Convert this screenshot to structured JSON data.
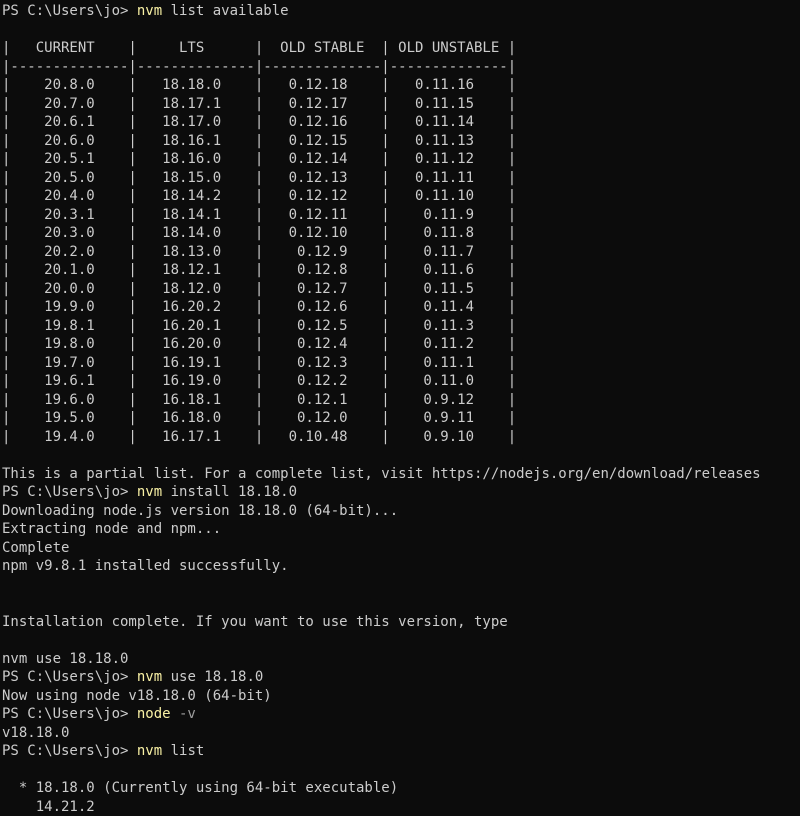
{
  "terminal": {
    "background": "#0c0c0c",
    "foreground": "#cccccc",
    "command_color": "#f9f1a5",
    "flag_color": "#9e9e9e",
    "lines": [
      {
        "type": "prompt",
        "prompt": "PS C:\\Users\\jo> ",
        "cmd": "nvm",
        "args": " list available"
      },
      {
        "type": "text",
        "text": ""
      },
      {
        "type": "text",
        "text": "|   CURRENT    |     LTS      |  OLD STABLE  | OLD UNSTABLE |"
      },
      {
        "type": "text",
        "text": "|--------------|--------------|--------------|--------------|"
      },
      {
        "type": "text",
        "text": "|    20.8.0    |   18.18.0    |   0.12.18    |   0.11.16    |"
      },
      {
        "type": "text",
        "text": "|    20.7.0    |   18.17.1    |   0.12.17    |   0.11.15    |"
      },
      {
        "type": "text",
        "text": "|    20.6.1    |   18.17.0    |   0.12.16    |   0.11.14    |"
      },
      {
        "type": "text",
        "text": "|    20.6.0    |   18.16.1    |   0.12.15    |   0.11.13    |"
      },
      {
        "type": "text",
        "text": "|    20.5.1    |   18.16.0    |   0.12.14    |   0.11.12    |"
      },
      {
        "type": "text",
        "text": "|    20.5.0    |   18.15.0    |   0.12.13    |   0.11.11    |"
      },
      {
        "type": "text",
        "text": "|    20.4.0    |   18.14.2    |   0.12.12    |   0.11.10    |"
      },
      {
        "type": "text",
        "text": "|    20.3.1    |   18.14.1    |   0.12.11    |    0.11.9    |"
      },
      {
        "type": "text",
        "text": "|    20.3.0    |   18.14.0    |   0.12.10    |    0.11.8    |"
      },
      {
        "type": "text",
        "text": "|    20.2.0    |   18.13.0    |    0.12.9    |    0.11.7    |"
      },
      {
        "type": "text",
        "text": "|    20.1.0    |   18.12.1    |    0.12.8    |    0.11.6    |"
      },
      {
        "type": "text",
        "text": "|    20.0.0    |   18.12.0    |    0.12.7    |    0.11.5    |"
      },
      {
        "type": "text",
        "text": "|    19.9.0    |   16.20.2    |    0.12.6    |    0.11.4    |"
      },
      {
        "type": "text",
        "text": "|    19.8.1    |   16.20.1    |    0.12.5    |    0.11.3    |"
      },
      {
        "type": "text",
        "text": "|    19.8.0    |   16.20.0    |    0.12.4    |    0.11.2    |"
      },
      {
        "type": "text",
        "text": "|    19.7.0    |   16.19.1    |    0.12.3    |    0.11.1    |"
      },
      {
        "type": "text",
        "text": "|    19.6.1    |   16.19.0    |    0.12.2    |    0.11.0    |"
      },
      {
        "type": "text",
        "text": "|    19.6.0    |   16.18.1    |    0.12.1    |    0.9.12    |"
      },
      {
        "type": "text",
        "text": "|    19.5.0    |   16.18.0    |    0.12.0    |    0.9.11    |"
      },
      {
        "type": "text",
        "text": "|    19.4.0    |   16.17.1    |   0.10.48    |    0.9.10    |"
      },
      {
        "type": "text",
        "text": ""
      },
      {
        "type": "text",
        "text": "This is a partial list. For a complete list, visit https://nodejs.org/en/download/releases"
      },
      {
        "type": "prompt",
        "prompt": "PS C:\\Users\\jo> ",
        "cmd": "nvm",
        "args": " install 18.18.0"
      },
      {
        "type": "text",
        "text": "Downloading node.js version 18.18.0 (64-bit)..."
      },
      {
        "type": "text",
        "text": "Extracting node and npm..."
      },
      {
        "type": "text",
        "text": "Complete"
      },
      {
        "type": "text",
        "text": "npm v9.8.1 installed successfully."
      },
      {
        "type": "text",
        "text": ""
      },
      {
        "type": "text",
        "text": ""
      },
      {
        "type": "text",
        "text": "Installation complete. If you want to use this version, type"
      },
      {
        "type": "text",
        "text": ""
      },
      {
        "type": "text",
        "text": "nvm use 18.18.0"
      },
      {
        "type": "prompt",
        "prompt": "PS C:\\Users\\jo> ",
        "cmd": "nvm",
        "args": " use 18.18.0"
      },
      {
        "type": "text",
        "text": "Now using node v18.18.0 (64-bit)"
      },
      {
        "type": "prompt",
        "prompt": "PS C:\\Users\\jo> ",
        "cmd": "node",
        "args": "",
        "flag": " -v"
      },
      {
        "type": "text",
        "text": "v18.18.0"
      },
      {
        "type": "prompt",
        "prompt": "PS C:\\Users\\jo> ",
        "cmd": "nvm",
        "args": " list"
      },
      {
        "type": "text",
        "text": ""
      },
      {
        "type": "text",
        "text": "  * 18.18.0 (Currently using 64-bit executable)"
      },
      {
        "type": "text",
        "text": "    14.21.2"
      }
    ]
  }
}
